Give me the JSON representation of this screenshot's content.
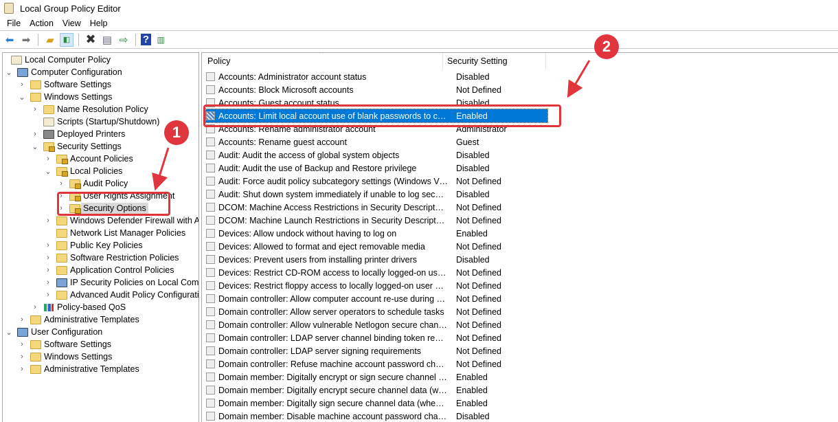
{
  "window": {
    "title": "Local Group Policy Editor"
  },
  "menu": [
    "File",
    "Action",
    "View",
    "Help"
  ],
  "toolbar": [
    "back-icon",
    "forward-icon",
    "up-folder-icon",
    "show-hide-tree-icon",
    "delete-icon",
    "properties-icon",
    "export-list-icon",
    "help-icon",
    "show-hide-action-pane-icon"
  ],
  "tree": [
    {
      "label": "Local Computer Policy",
      "level": 0,
      "state": "none",
      "icon": "doc"
    },
    {
      "label": "Computer Configuration",
      "level": 1,
      "state": "open",
      "icon": "comp"
    },
    {
      "label": "Software Settings",
      "level": 2,
      "state": "closed",
      "icon": "folder"
    },
    {
      "label": "Windows Settings",
      "level": 2,
      "state": "open",
      "icon": "folder"
    },
    {
      "label": "Name Resolution Policy",
      "level": 3,
      "state": "closed",
      "icon": "folder"
    },
    {
      "label": "Scripts (Startup/Shutdown)",
      "level": 3,
      "state": "none",
      "icon": "doc"
    },
    {
      "label": "Deployed Printers",
      "level": 3,
      "state": "closed",
      "icon": "print"
    },
    {
      "label": "Security Settings",
      "level": 3,
      "state": "open",
      "icon": "lock"
    },
    {
      "label": "Account Policies",
      "level": 4,
      "state": "closed",
      "icon": "lock"
    },
    {
      "label": "Local Policies",
      "level": 4,
      "state": "open",
      "icon": "lock"
    },
    {
      "label": "Audit Policy",
      "level": 5,
      "state": "closed",
      "icon": "lock"
    },
    {
      "label": "User Rights Assignment",
      "level": 5,
      "state": "closed",
      "icon": "lock"
    },
    {
      "label": "Security Options",
      "level": 5,
      "state": "closed",
      "icon": "lock",
      "selected": true
    },
    {
      "label": "Windows Defender Firewall with Advanced Security",
      "level": 4,
      "state": "closed",
      "icon": "folder"
    },
    {
      "label": "Network List Manager Policies",
      "level": 4,
      "state": "none",
      "icon": "folder"
    },
    {
      "label": "Public Key Policies",
      "level": 4,
      "state": "closed",
      "icon": "folder"
    },
    {
      "label": "Software Restriction Policies",
      "level": 4,
      "state": "closed",
      "icon": "folder"
    },
    {
      "label": "Application Control Policies",
      "level": 4,
      "state": "closed",
      "icon": "folder"
    },
    {
      "label": "IP Security Policies on Local Computer",
      "level": 4,
      "state": "closed",
      "icon": "comp"
    },
    {
      "label": "Advanced Audit Policy Configuration",
      "level": 4,
      "state": "closed",
      "icon": "folder"
    },
    {
      "label": "Policy-based QoS",
      "level": 3,
      "state": "closed",
      "icon": "chart"
    },
    {
      "label": "Administrative Templates",
      "level": 2,
      "state": "closed",
      "icon": "folder"
    },
    {
      "label": "User Configuration",
      "level": 1,
      "state": "open",
      "icon": "comp"
    },
    {
      "label": "Software Settings",
      "level": 2,
      "state": "closed",
      "icon": "folder"
    },
    {
      "label": "Windows Settings",
      "level": 2,
      "state": "closed",
      "icon": "folder"
    },
    {
      "label": "Administrative Templates",
      "level": 2,
      "state": "closed",
      "icon": "folder"
    }
  ],
  "list": {
    "columns": [
      "Policy",
      "Security Setting"
    ],
    "rows": [
      [
        "Accounts: Administrator account status",
        "Disabled"
      ],
      [
        "Accounts: Block Microsoft accounts",
        "Not Defined"
      ],
      [
        "Accounts: Guest account status",
        "Disabled"
      ],
      [
        "Accounts: Limit local account use of blank passwords to co...",
        "Enabled"
      ],
      [
        "Accounts: Rename administrator account",
        "Administrator"
      ],
      [
        "Accounts: Rename guest account",
        "Guest"
      ],
      [
        "Audit: Audit the access of global system objects",
        "Disabled"
      ],
      [
        "Audit: Audit the use of Backup and Restore privilege",
        "Disabled"
      ],
      [
        "Audit: Force audit policy subcategory settings (Windows Vis...",
        "Not Defined"
      ],
      [
        "Audit: Shut down system immediately if unable to log secur...",
        "Disabled"
      ],
      [
        "DCOM: Machine Access Restrictions in Security Descriptor D...",
        "Not Defined"
      ],
      [
        "DCOM: Machine Launch Restrictions in Security Descriptor ...",
        "Not Defined"
      ],
      [
        "Devices: Allow undock without having to log on",
        "Enabled"
      ],
      [
        "Devices: Allowed to format and eject removable media",
        "Not Defined"
      ],
      [
        "Devices: Prevent users from installing printer drivers",
        "Disabled"
      ],
      [
        "Devices: Restrict CD-ROM access to locally logged-on user ...",
        "Not Defined"
      ],
      [
        "Devices: Restrict floppy access to locally logged-on user only",
        "Not Defined"
      ],
      [
        "Domain controller: Allow computer account re-use during d...",
        "Not Defined"
      ],
      [
        "Domain controller: Allow server operators to schedule tasks",
        "Not Defined"
      ],
      [
        "Domain controller: Allow vulnerable Netlogon secure chann...",
        "Not Defined"
      ],
      [
        "Domain controller: LDAP server channel binding token requi...",
        "Not Defined"
      ],
      [
        "Domain controller: LDAP server signing requirements",
        "Not Defined"
      ],
      [
        "Domain controller: Refuse machine account password chan...",
        "Not Defined"
      ],
      [
        "Domain member: Digitally encrypt or sign secure channel d...",
        "Enabled"
      ],
      [
        "Domain member: Digitally encrypt secure channel data (wh...",
        "Enabled"
      ],
      [
        "Domain member: Digitally sign secure channel data (when ...",
        "Enabled"
      ],
      [
        "Domain member: Disable machine account password chan...",
        "Disabled"
      ]
    ],
    "selected_index": 3
  },
  "annotations": {
    "badge1": "1",
    "badge2": "2",
    "color": "#e0353c"
  }
}
